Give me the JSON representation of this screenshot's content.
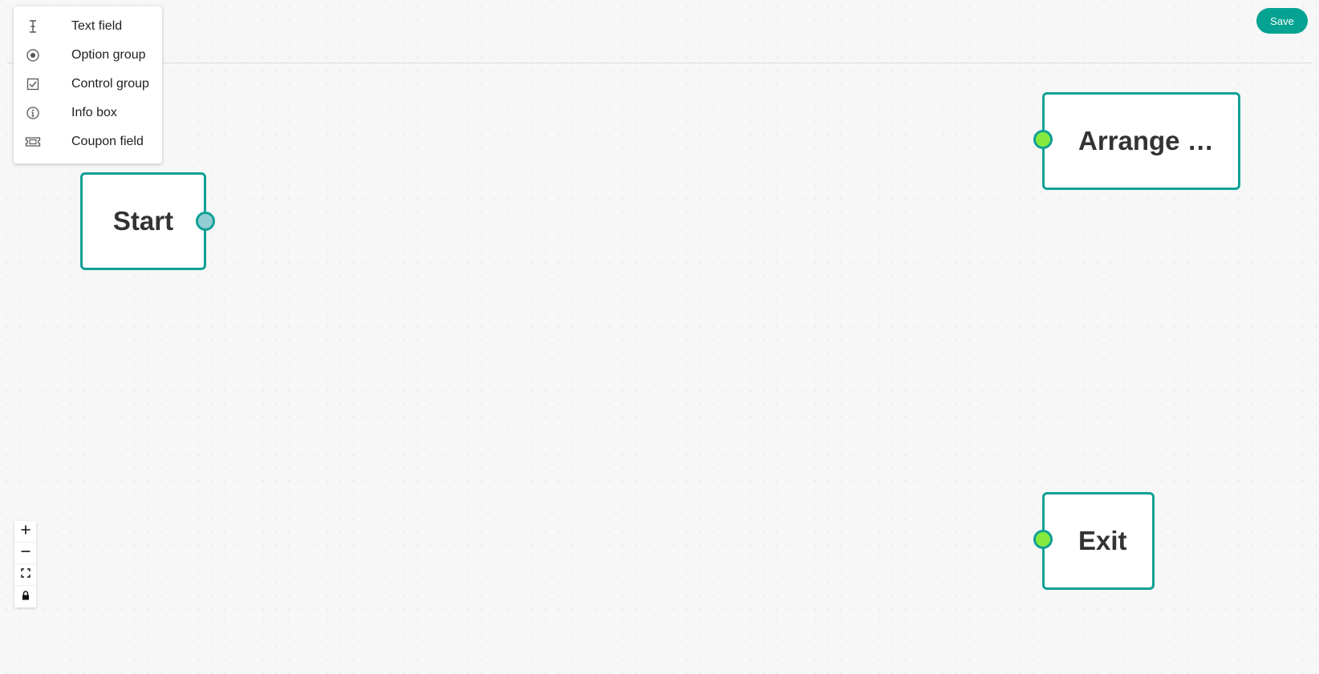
{
  "toolbar": {
    "save_label": "Save",
    "accent_color": "#07a392"
  },
  "palette": {
    "items": [
      {
        "label": "Text field",
        "icon": "text-cursor-icon"
      },
      {
        "label": "Option group",
        "icon": "radio-button-icon"
      },
      {
        "label": "Control group",
        "icon": "checkbox-icon"
      },
      {
        "label": "Info box",
        "icon": "info-icon"
      },
      {
        "label": "Coupon field",
        "icon": "ticket-icon"
      }
    ]
  },
  "canvas": {
    "nodes": [
      {
        "label": "Start",
        "port": "output",
        "port_color": "#93ccd3"
      },
      {
        "label": "Arrange …",
        "port": "input",
        "port_color": "#86ea3e"
      },
      {
        "label": "Exit",
        "port": "input",
        "port_color": "#86ea3e"
      }
    ],
    "node_border_color": "#10a096"
  },
  "controls": {
    "zoom_in": "zoom-in-icon",
    "zoom_out": "zoom-out-icon",
    "fit_view": "fit-view-icon",
    "lock": "lock-icon"
  }
}
